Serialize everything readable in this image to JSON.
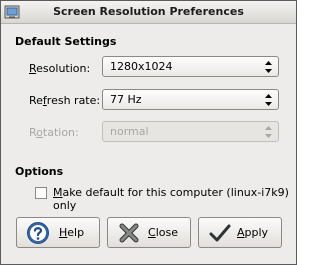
{
  "window": {
    "title": "Screen Resolution Preferences"
  },
  "default_settings": {
    "heading": "Default Settings",
    "resolution": {
      "label_mnemonic": "R",
      "label_rest": "esolution:",
      "value": "1280x1024"
    },
    "refresh_rate": {
      "label_pre": "Re",
      "label_mnemonic": "f",
      "label_rest": "resh rate:",
      "value": "77 Hz"
    },
    "rotation": {
      "label_pre": "R",
      "label_mnemonic": "o",
      "label_rest": "tation:",
      "value": "normal"
    }
  },
  "options": {
    "heading": "Options",
    "make_default": {
      "label_mnemonic": "M",
      "label_rest": "ake default for this computer (linux-i7k9) only",
      "checked": false
    }
  },
  "buttons": {
    "help": {
      "mnemonic": "H",
      "rest": "elp",
      "icon": "help-icon"
    },
    "close": {
      "mnemonic": "C",
      "rest": "lose",
      "icon": "close-icon"
    },
    "apply": {
      "mnemonic": "A",
      "rest": "pply",
      "icon": "checkmark-icon"
    }
  },
  "colors": {
    "disabled_text": "#a9a7a3",
    "help_icon_blue": "#3465a4",
    "close_icon_gray": "#555753",
    "apply_icon_dark": "#2e3436"
  }
}
